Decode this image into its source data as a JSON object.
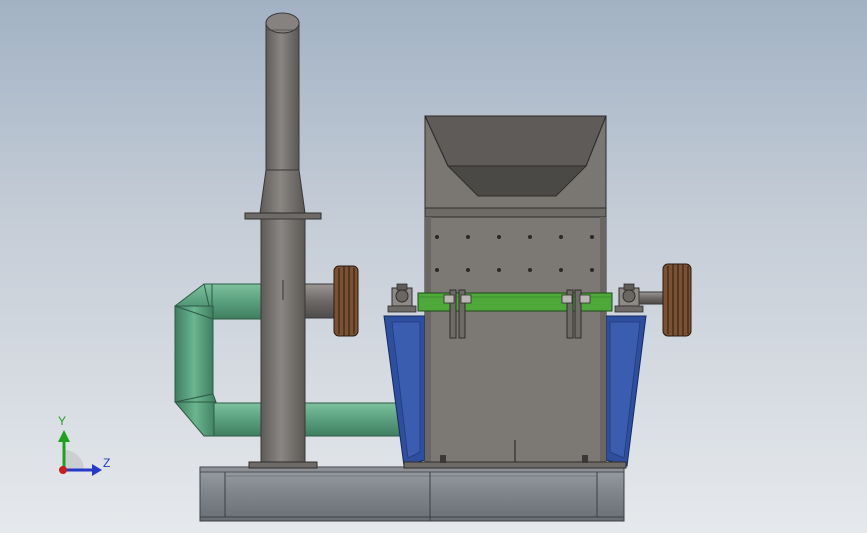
{
  "viewport": {
    "background_top": "#a2b2c4",
    "background_bottom": "#e6e9ec"
  },
  "model": {
    "parts": [
      {
        "name": "exhaust-stack",
        "color": "#7a7673"
      },
      {
        "name": "feed-hopper",
        "color": "#76736f"
      },
      {
        "name": "crusher-body",
        "color": "#7c7873"
      },
      {
        "name": "mounting-bar",
        "color": "#4ea83a"
      },
      {
        "name": "side-guard",
        "color": "#2e4f9e"
      },
      {
        "name": "return-duct",
        "color": "#5da383"
      },
      {
        "name": "v-belt-pulley",
        "color": "#8a5a38"
      },
      {
        "name": "base-frame",
        "color": "#82858c"
      }
    ]
  },
  "triad": {
    "y_label": "Y",
    "z_label": "Z",
    "y_color": "#1fa01f",
    "z_color": "#2538c8",
    "x_color": "#c81e1e"
  }
}
